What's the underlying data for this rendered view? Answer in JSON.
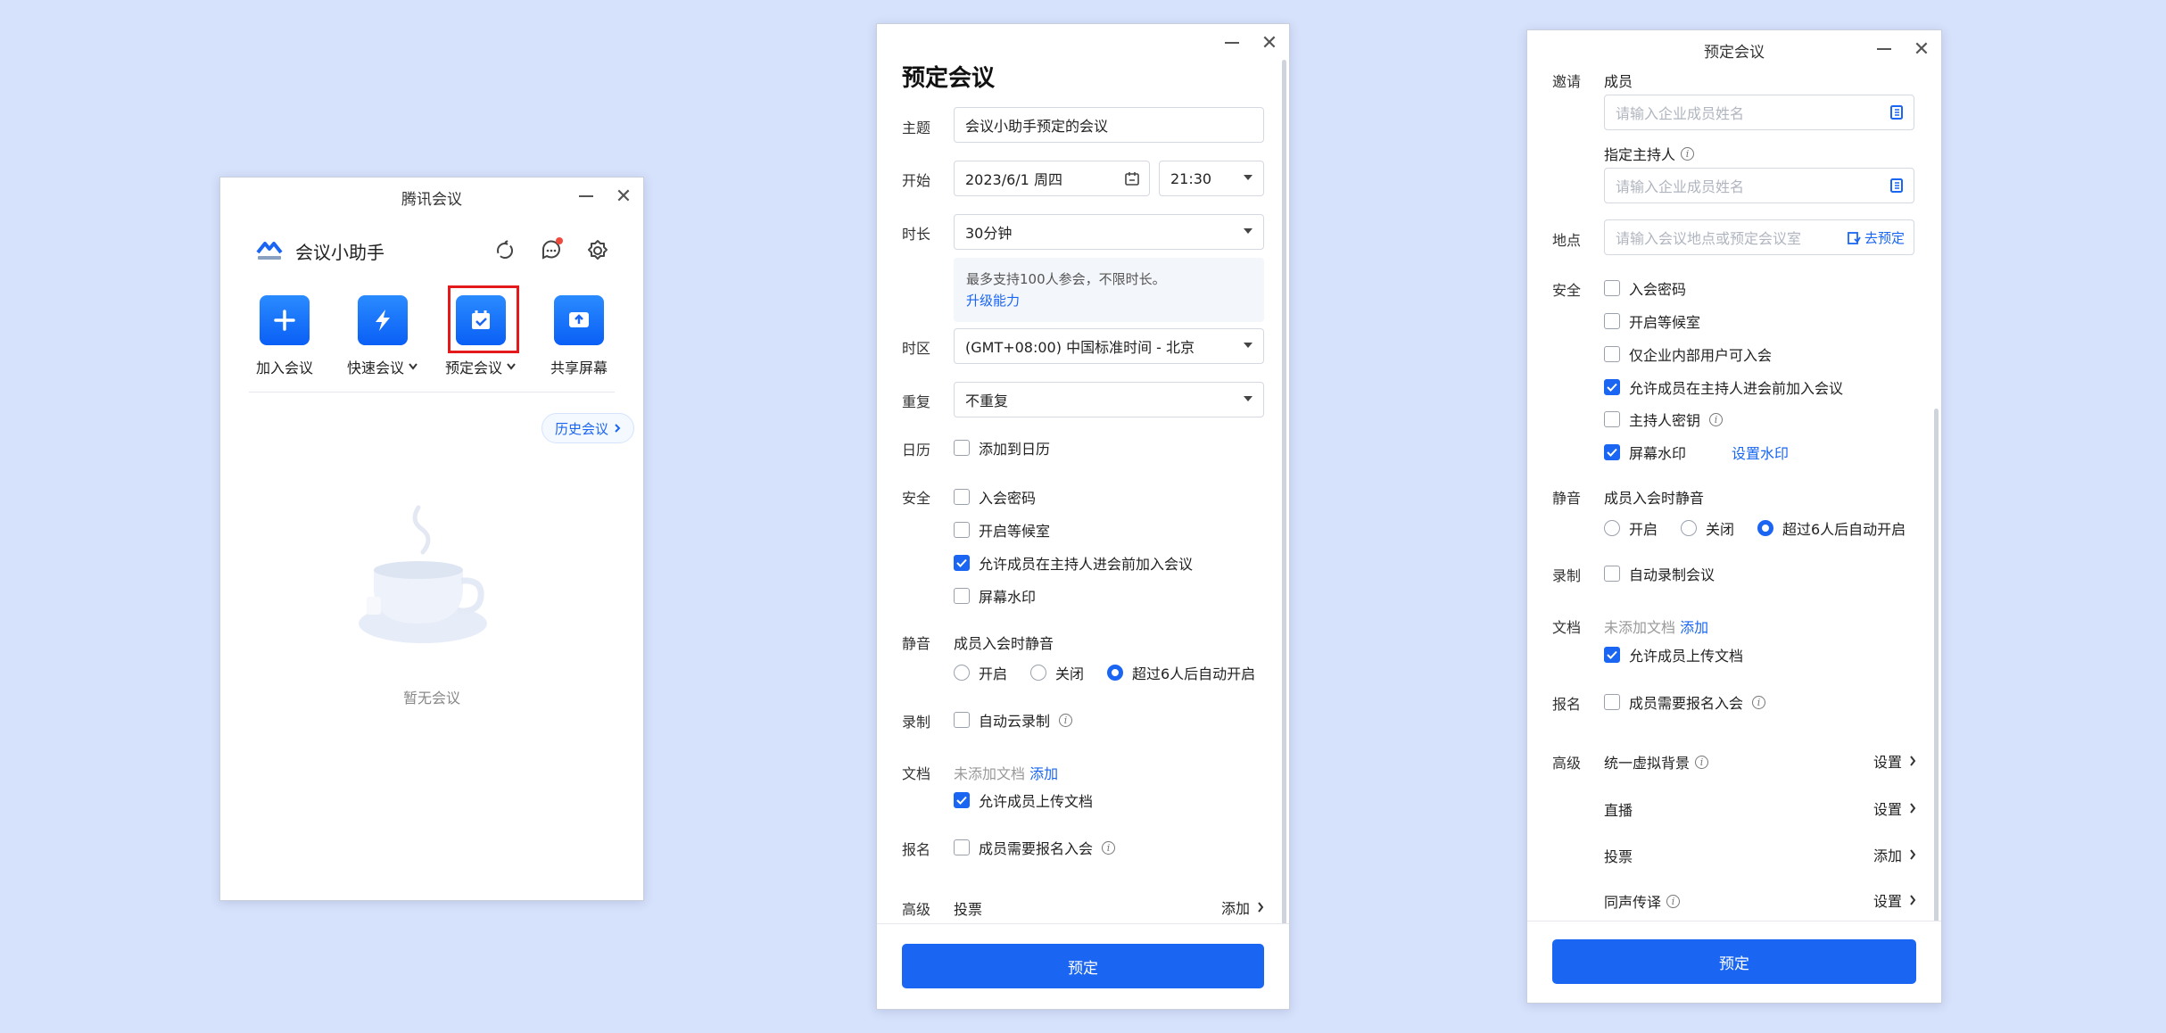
{
  "w1": {
    "title": "腾讯会议",
    "user_name": "会议小助手",
    "actions": [
      {
        "label": "加入会议",
        "icon": "plus-icon"
      },
      {
        "label": "快速会议",
        "icon": "lightning-icon"
      },
      {
        "label": "预定会议",
        "icon": "calendar-icon"
      },
      {
        "label": "共享屏幕",
        "icon": "share-screen-icon"
      }
    ],
    "history_label": "历史会议",
    "empty_text": "暂无会议"
  },
  "w2": {
    "title": "预定会议",
    "subject_label": "主题",
    "subject_value": "会议小助手预定的会议",
    "start_label": "开始",
    "start_date": "2023/6/1 周四",
    "start_time": "21:30",
    "duration_label": "时长",
    "duration_value": "30分钟",
    "tip_text": "最多支持100人参会，不限时长。",
    "tip_link": "升级能力",
    "timezone_label": "时区",
    "timezone_value": "(GMT+08:00) 中国标准时间 - 北京",
    "repeat_label": "重复",
    "repeat_value": "不重复",
    "calendar_label": "日历",
    "calendar_option": "添加到日历",
    "security_label": "安全",
    "security_options": [
      "入会密码",
      "开启等候室",
      "允许成员在主持人进会前加入会议",
      "屏幕水印"
    ],
    "mute_label": "静音",
    "mute_title": "成员入会时静音",
    "mute_options": [
      "开启",
      "关闭",
      "超过6人后自动开启"
    ],
    "record_label": "录制",
    "record_option": "自动云录制",
    "doc_label": "文档",
    "doc_empty": "未添加文档",
    "doc_add": "添加",
    "doc_option": "允许成员上传文档",
    "signup_label": "报名",
    "signup_option": "成员需要报名入会",
    "advanced_label": "高级",
    "advanced_item": "投票",
    "advanced_action": "添加",
    "submit": "预定"
  },
  "w3": {
    "title": "预定会议",
    "invite_label": "邀请",
    "members_title": "成员",
    "members_placeholder": "请输入企业成员姓名",
    "host_title": "指定主持人",
    "host_placeholder": "请输入企业成员姓名",
    "location_label": "地点",
    "location_placeholder": "请输入会议地点或预定会议室",
    "location_action": "去预定",
    "security_label": "安全",
    "security_options": [
      "入会密码",
      "开启等候室",
      "仅企业内部用户可入会",
      "允许成员在主持人进会前加入会议",
      "主持人密钥",
      "屏幕水印"
    ],
    "watermark_link": "设置水印",
    "mute_label": "静音",
    "mute_title": "成员入会时静音",
    "mute_options": [
      "开启",
      "关闭",
      "超过6人后自动开启"
    ],
    "record_label": "录制",
    "record_option": "自动录制会议",
    "doc_label": "文档",
    "doc_empty": "未添加文档",
    "doc_add": "添加",
    "doc_option": "允许成员上传文档",
    "signup_label": "报名",
    "signup_option": "成员需要报名入会",
    "advanced_label": "高级",
    "advanced_items": [
      {
        "name": "统一虚拟背景",
        "action": "设置"
      },
      {
        "name": "直播",
        "action": "设置"
      },
      {
        "name": "投票",
        "action": "添加"
      },
      {
        "name": "同声传译",
        "action": "设置"
      }
    ],
    "submit": "预定"
  }
}
